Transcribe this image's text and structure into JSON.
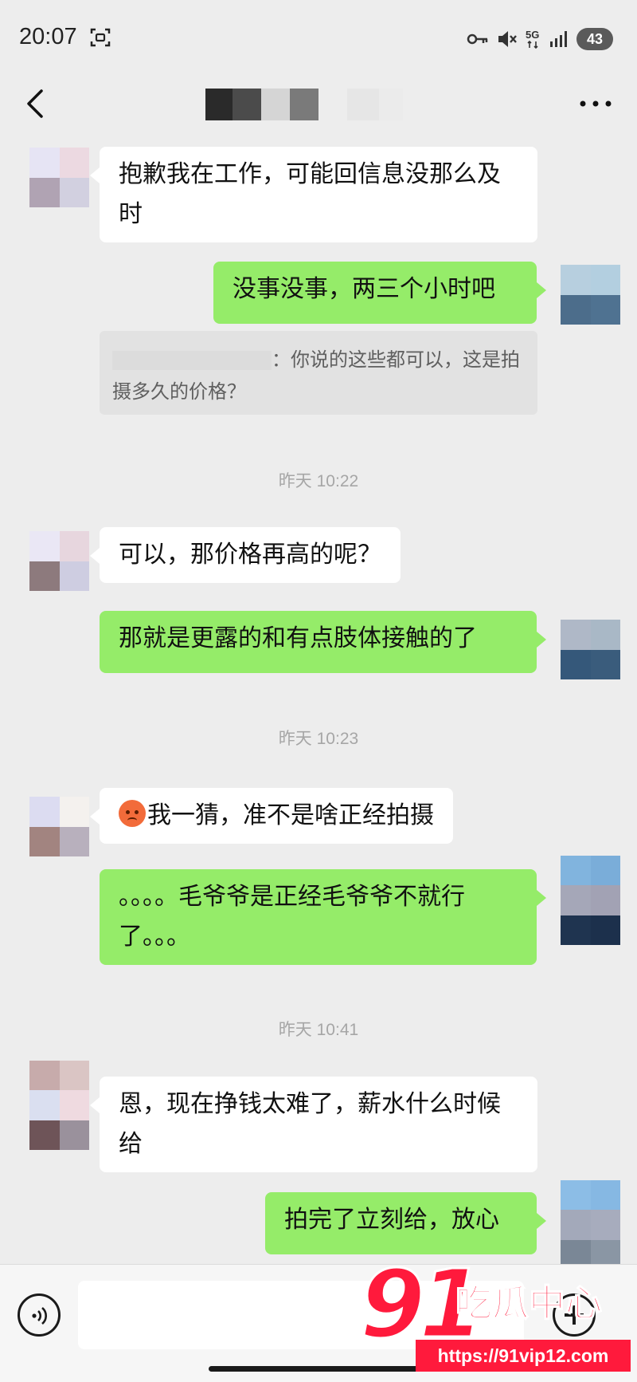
{
  "status_bar": {
    "time": "20:07",
    "network": "5G",
    "battery": "43",
    "icons": [
      "screen-record-icon",
      "key-icon",
      "mute-icon",
      "5g-icon",
      "signal-icon",
      "battery-icon"
    ]
  },
  "header": {
    "title_redacted": true,
    "icons": [
      "back-chevron-icon",
      "more-dots-icon"
    ]
  },
  "messages": [
    {
      "id": "m1",
      "side": "in",
      "text": "抱歉我在工作，可能回信息没那么及时"
    },
    {
      "id": "m2",
      "side": "out",
      "text": "没事没事，两三个小时吧"
    },
    {
      "id": "q1",
      "type": "quote",
      "text": "：你说的这些都可以，这是拍摄多久的价格？"
    },
    {
      "id": "t1",
      "type": "time",
      "text": "昨天 10:22"
    },
    {
      "id": "m3",
      "side": "in",
      "text": "可以，那价格再高的呢？"
    },
    {
      "id": "m4",
      "side": "out",
      "text": "那就是更露的和有点肢体接触的了"
    },
    {
      "id": "t2",
      "type": "time",
      "text": "昨天 10:23"
    },
    {
      "id": "m5",
      "side": "in",
      "emoji": "sweat-face-emoji",
      "text": "我一猜，准不是啥正经拍摄"
    },
    {
      "id": "m6",
      "side": "out",
      "text": "。。。。毛爷爷是正经毛爷爷不就行了。。。"
    },
    {
      "id": "t3",
      "type": "time",
      "text": "昨天 10:41"
    },
    {
      "id": "m7",
      "side": "in",
      "text": "恩，现在挣钱太难了，薪水什么时候给"
    },
    {
      "id": "m8",
      "side": "out",
      "text": "拍完了立刻给，放心"
    }
  ],
  "input_bar": {
    "value": "",
    "icons": [
      "voice-icon",
      "plus-icon"
    ]
  },
  "watermark": {
    "number": "91",
    "name": "吃瓜中心",
    "url": "https://91vip12.com"
  },
  "colors": {
    "background": "#ededed",
    "incoming_bubble": "#ffffff",
    "outgoing_bubble": "#95ec69",
    "timestamp": "#a6a6a6",
    "watermark": "#ff1a3c"
  }
}
